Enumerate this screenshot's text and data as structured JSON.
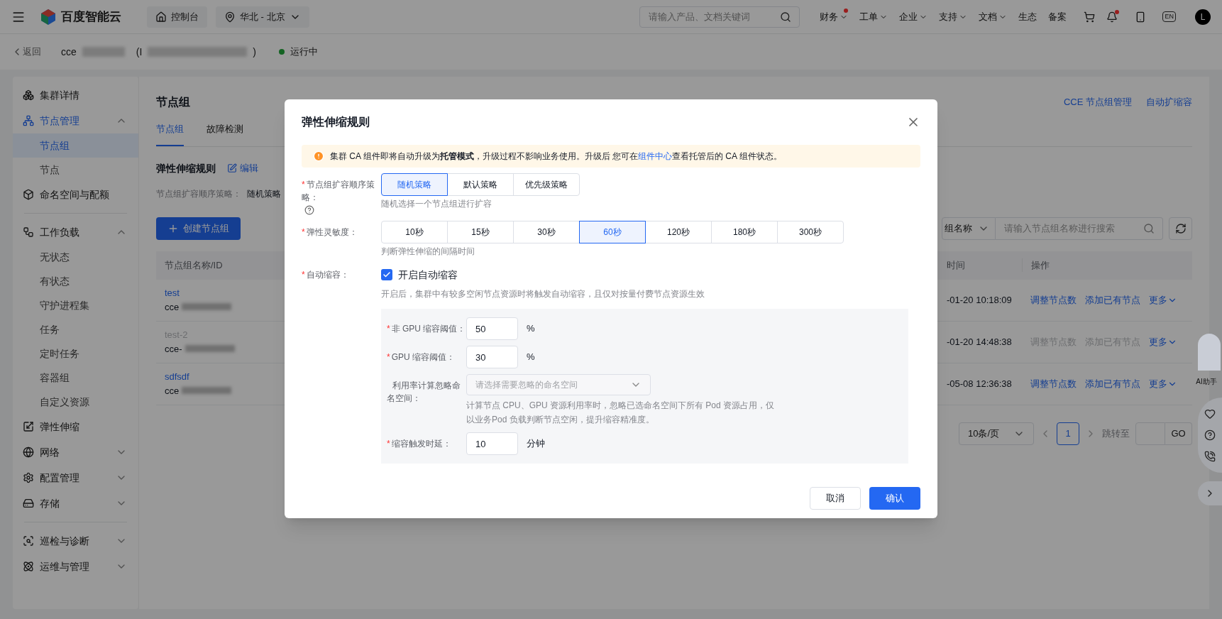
{
  "topbar": {
    "brand": "百度智能云",
    "console": "控制台",
    "region": "华北 - 北京",
    "search_placeholder": "请输入产品、文档关键词",
    "nav": [
      {
        "label": "财务",
        "caret": true,
        "badge": true
      },
      {
        "label": "工单",
        "caret": true,
        "badge": false
      },
      {
        "label": "企业",
        "caret": true,
        "badge": false
      },
      {
        "label": "支持",
        "caret": true,
        "badge": false
      },
      {
        "label": "文档",
        "caret": true,
        "badge": false
      },
      {
        "label": "生态",
        "caret": false,
        "badge": false
      },
      {
        "label": "备案",
        "caret": false,
        "badge": false
      }
    ],
    "notification_badge": true,
    "language": "EN",
    "avatar": "L"
  },
  "breadcrumb": {
    "back": "返回",
    "cluster_name": "cce",
    "cluster_id_open": "(I",
    "cluster_id_close": ")",
    "status": "运行中"
  },
  "sidebar": {
    "sections": [
      [
        {
          "label": "集群详情",
          "selected": false
        },
        {
          "label": "节点管理",
          "selected": true,
          "expanded": true,
          "children": [
            {
              "label": "节点组",
              "selected": true
            },
            {
              "label": "节点",
              "selected": false
            }
          ]
        },
        {
          "label": "命名空间与配额",
          "selected": false
        }
      ],
      [
        {
          "label": "工作负载",
          "selected": false,
          "expanded": true,
          "children": [
            {
              "label": "无状态",
              "selected": false
            },
            {
              "label": "有状态",
              "selected": false
            },
            {
              "label": "守护进程集",
              "selected": false
            },
            {
              "label": "任务",
              "selected": false
            },
            {
              "label": "定时任务",
              "selected": false
            },
            {
              "label": "容器组",
              "selected": false
            },
            {
              "label": "自定义资源",
              "selected": false
            }
          ]
        },
        {
          "label": "弹性伸缩",
          "selected": false
        },
        {
          "label": "网络",
          "selected": false,
          "expanded": false
        },
        {
          "label": "配置管理",
          "selected": false,
          "expanded": false
        },
        {
          "label": "存储",
          "selected": false,
          "expanded": false
        }
      ],
      [
        {
          "label": "巡检与诊断",
          "selected": false,
          "expanded": false
        },
        {
          "label": "运维与管理",
          "selected": false,
          "expanded": false
        }
      ]
    ]
  },
  "main": {
    "title": "节点组",
    "header_links": [
      "CCE 节点组管理",
      "自动扩缩容"
    ],
    "tabs": [
      {
        "label": "节点组",
        "selected": true
      },
      {
        "label": "故障检测",
        "selected": false
      }
    ],
    "rule_title": "弹性伸缩规则",
    "edit": "编辑",
    "strategy_label": "节点组扩容顺序策略：",
    "strategy_value": "随机策略",
    "create_button": "创建节点组",
    "search_field_select": "组名称",
    "search_placeholder": "请输入节点组名称进行搜索",
    "table": {
      "columns": [
        "节点组名称/ID",
        "时间",
        "操作"
      ],
      "rows": [
        {
          "name": "test",
          "disabled": false,
          "id": "cce",
          "time": "-01-20 10:18:09",
          "actions": [
            {
              "label": "调整节点数",
              "disabled": false
            },
            {
              "label": "添加已有节点",
              "disabled": false
            }
          ],
          "more": "更多"
        },
        {
          "name": "test-2",
          "disabled": true,
          "id": "cce-",
          "time": "-01-20 14:48:38",
          "actions": [
            {
              "label": "调整节点数",
              "disabled": true
            },
            {
              "label": "添加已有节点",
              "disabled": true
            }
          ],
          "more": "更多"
        },
        {
          "name": "sdfsdf",
          "disabled": false,
          "id": "cce",
          "time": "-05-08 12:36:38",
          "actions": [
            {
              "label": "调整节点数",
              "disabled": false
            },
            {
              "label": "添加已有节点",
              "disabled": false
            }
          ],
          "more": "更多"
        }
      ]
    },
    "pagination": {
      "page_size": "10条/页",
      "pages": [
        {
          "label": "1",
          "selected": true
        }
      ],
      "jump_label": "跳转至",
      "go": "GO"
    }
  },
  "assistant": {
    "label": "AI助手"
  },
  "dialog": {
    "title": "弹性伸缩规则",
    "required_mark": "*",
    "alert": {
      "before": "集群 CA 组件即将自动升级为**托管模式**，升级过程不影响业务使用。升级后 您可在",
      "link": "组件中心",
      "after": "查看托管后的 CA 组件状态。"
    },
    "fields": [
      {
        "kind": "segmented",
        "required": true,
        "label": "节点组扩容顺序策略：",
        "help": true,
        "options": [
          {
            "label": "随机策略",
            "selected": true
          },
          {
            "label": "默认策略",
            "selected": false
          },
          {
            "label": "优先级策略",
            "selected": false
          }
        ],
        "hint": "随机选择一个节点组进行扩容"
      },
      {
        "kind": "segmented",
        "required": true,
        "label": "弹性灵敏度：",
        "options": [
          {
            "label": "10秒",
            "selected": false
          },
          {
            "label": "15秒",
            "selected": false
          },
          {
            "label": "30秒",
            "selected": false
          },
          {
            "label": "60秒",
            "selected": true
          },
          {
            "label": "120秒",
            "selected": false
          },
          {
            "label": "180秒",
            "selected": false
          },
          {
            "label": "300秒",
            "selected": false
          }
        ],
        "hint": "判断弹性伸缩的间隔时间"
      },
      {
        "kind": "checkbox",
        "required": true,
        "label": "自动缩容：",
        "checkbox_label": "开启自动缩容",
        "checked": true,
        "hint": "开启后，集群中有较多空闲节点资源时将触发自动缩容，且仅对按量付费节点资源生效"
      }
    ],
    "subfields": [
      {
        "kind": "number",
        "required": true,
        "label": "非 GPU 缩容阈值：",
        "value": "50",
        "unit": "%"
      },
      {
        "kind": "number",
        "required": true,
        "label": "GPU 缩容阈值：",
        "value": "30",
        "unit": "%"
      },
      {
        "kind": "select",
        "required": false,
        "label": "利用率计算忽略命名空间：",
        "placeholder": "请选择需要忽略的命名空间",
        "hint": "计算节点 CPU、GPU 资源利用率时，忽略已选命名空间下所有 Pod 资源占用，仅以业务Pod 负载判断节点空闲，提升缩容精准度。"
      },
      {
        "kind": "number",
        "required": true,
        "label": "缩容触发时延：",
        "value": "10",
        "unit": "分钟"
      }
    ],
    "cancel": "取消",
    "confirm": "确认"
  }
}
